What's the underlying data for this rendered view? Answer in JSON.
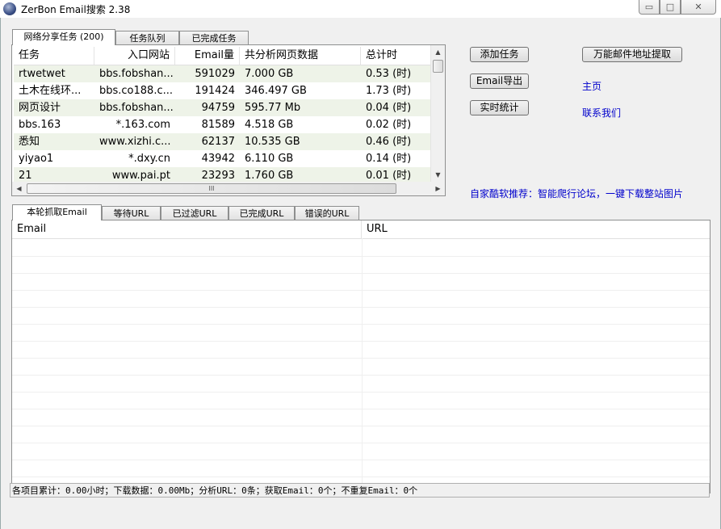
{
  "window": {
    "title": "ZerBon Email搜索 2.38",
    "min": "▭",
    "max": "□",
    "close": "✕"
  },
  "top_tabs": [
    "网络分享任务 (200)",
    "任务队列",
    "已完成任务"
  ],
  "task_table": {
    "columns": [
      "任务",
      "入口网站",
      "Email量",
      "共分析网页数据",
      "总计时"
    ],
    "rows": [
      [
        "rtwetwet",
        "bbs.fobshan...",
        "591029",
        "7.000 GB",
        "0.53 (时)"
      ],
      [
        "土木在线环...",
        "bbs.co188.c...",
        "191424",
        "346.497 GB",
        "1.73 (时)"
      ],
      [
        "网页设计",
        "bbs.fobshan...",
        "94759",
        "595.77 Mb",
        "0.04 (时)"
      ],
      [
        "bbs.163",
        "*.163.com",
        "81589",
        "4.518 GB",
        "0.02 (时)"
      ],
      [
        "悉知",
        "www.xizhi.c...",
        "62137",
        "10.535 GB",
        "0.46 (时)"
      ],
      [
        "yiyao1",
        "*.dxy.cn",
        "43942",
        "6.110 GB",
        "0.14 (时)"
      ],
      [
        "21",
        "www.pai.pt",
        "23293",
        "1.760 GB",
        "0.01 (时)"
      ]
    ]
  },
  "buttons": {
    "add_task": "添加任务",
    "email_export": "Email导出",
    "realtime_stats": "实时统计",
    "universal_extract": "万能邮件地址提取"
  },
  "links": {
    "home": "主页",
    "contact": "联系我们",
    "promo": "自家酷软推荐：智能爬行论坛，一键下载整站图片"
  },
  "bottom_tabs": [
    "本轮抓取Email",
    "等待URL",
    "已过滤URL",
    "已完成URL",
    "错误的URL"
  ],
  "email_grid": {
    "columns": [
      "Email",
      "URL"
    ]
  },
  "status": "各项目累计：0.00小时；下载数据：0.00Mb；分析URL：0条；获取Email：0个；不重复Email：0个"
}
